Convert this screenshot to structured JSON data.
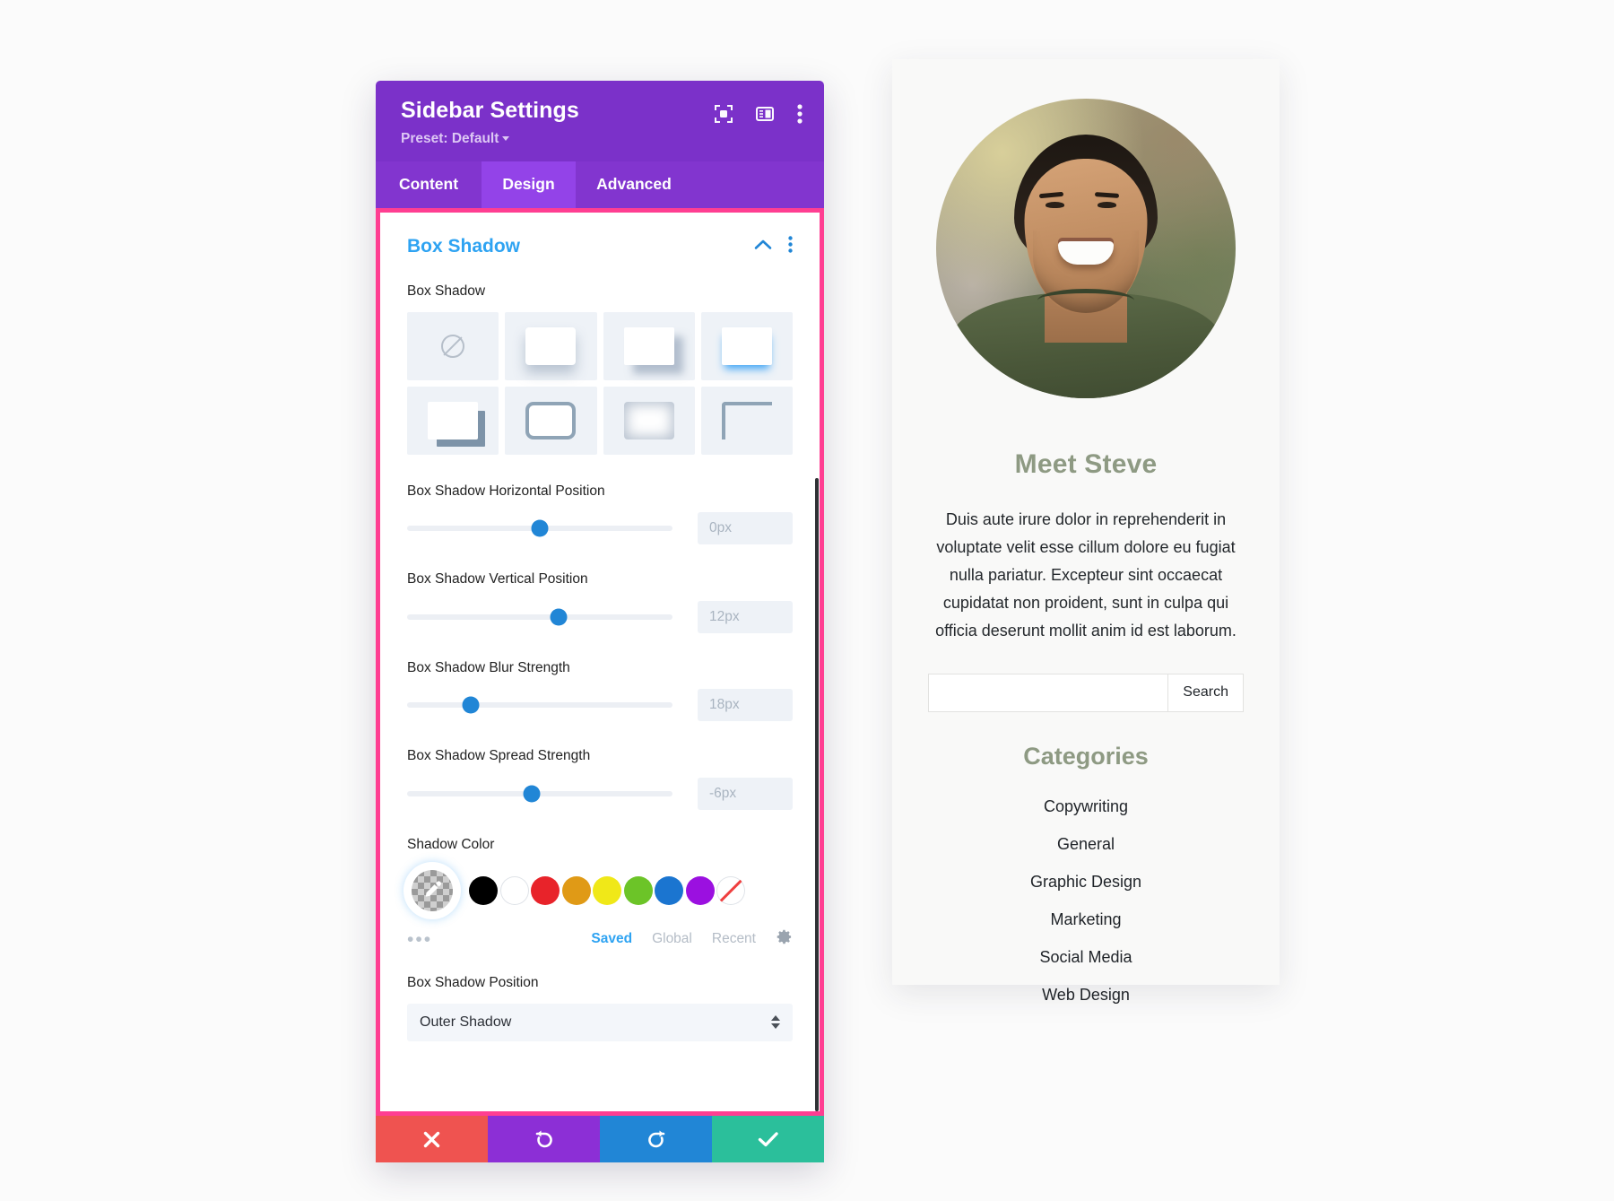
{
  "modal": {
    "title": "Sidebar Settings",
    "preset": "Preset: Default",
    "header_icons": [
      "target-icon",
      "layout-panel-icon",
      "kebab-menu-icon"
    ],
    "tabs": [
      {
        "label": "Content",
        "active": false
      },
      {
        "label": "Design",
        "active": true
      },
      {
        "label": "Advanced",
        "active": false
      }
    ],
    "section": {
      "title": "Box Shadow",
      "collapse_icon": "chevron-up-icon",
      "menu_icon": "kebab-menu-icon"
    },
    "fields": {
      "box_shadow_label": "Box Shadow",
      "presets": [
        "none",
        "shadow-soft-bottom",
        "shadow-offset-bottom-right",
        "shadow-blue-underline",
        "shadow-hard-offset",
        "shadow-border",
        "shadow-inset",
        "shadow-corner-bracket"
      ],
      "selected_preset_index": 5,
      "horizontal_position": {
        "label": "Box Shadow Horizontal Position",
        "value": "0px",
        "thumb_percent": 50
      },
      "vertical_position": {
        "label": "Box Shadow Vertical Position",
        "value": "12px",
        "thumb_percent": 57
      },
      "blur_strength": {
        "label": "Box Shadow Blur Strength",
        "value": "18px",
        "thumb_percent": 24
      },
      "spread_strength": {
        "label": "Box Shadow Spread Strength",
        "value": "-6px",
        "thumb_percent": 47
      },
      "shadow_color": {
        "label": "Shadow Color",
        "eyedropper_icon": "eyedropper-icon",
        "swatches": [
          {
            "name": "black",
            "hex": "#000000"
          },
          {
            "name": "white",
            "hex": "#ffffff"
          },
          {
            "name": "red",
            "hex": "#e8232a"
          },
          {
            "name": "orange",
            "hex": "#e09a16"
          },
          {
            "name": "yellow",
            "hex": "#f0e818"
          },
          {
            "name": "green",
            "hex": "#6cc428"
          },
          {
            "name": "blue",
            "hex": "#1b75d0"
          },
          {
            "name": "purple",
            "hex": "#9b10e0"
          }
        ],
        "more_dots": "•••",
        "palette_tabs": [
          {
            "label": "Saved",
            "active": true
          },
          {
            "label": "Global",
            "active": false
          },
          {
            "label": "Recent",
            "active": false
          }
        ],
        "settings_icon": "gear-icon"
      },
      "position": {
        "label": "Box Shadow Position",
        "value": "Outer Shadow"
      }
    },
    "footer": [
      {
        "name": "cancel-button",
        "icon": "close-icon",
        "color": "#ef5350"
      },
      {
        "name": "undo-button",
        "icon": "undo-icon",
        "color": "#8c2fd6"
      },
      {
        "name": "redo-button",
        "icon": "redo-icon",
        "color": "#2186d6"
      },
      {
        "name": "save-button",
        "icon": "check-icon",
        "color": "#2bbf9b"
      }
    ]
  },
  "preview": {
    "avatar_alt": "portrait-photo",
    "heading": "Meet Steve",
    "body": "Duis aute irure dolor in reprehenderit in voluptate velit esse cillum dolore eu fugiat nulla pariatur. Excepteur sint occaecat cupidatat non proident, sunt in culpa qui officia deserunt mollit anim id est laborum.",
    "search": {
      "value": "",
      "placeholder": "",
      "button_label": "Search"
    },
    "categories_heading": "Categories",
    "categories": [
      "Copywriting",
      "General",
      "Graphic Design",
      "Marketing",
      "Social Media",
      "Web Design"
    ]
  },
  "colors": {
    "modal_header": "#7b31c9",
    "tab_bar": "#8235cf",
    "tab_active": "#9343e8",
    "frame_accent": "#ff3e92",
    "section_title": "#2ea3f2",
    "slider_thumb": "#2186d6",
    "preview_heading": "#8e9a83"
  }
}
